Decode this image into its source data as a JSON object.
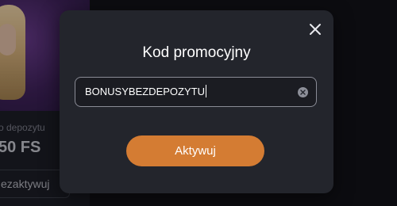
{
  "background": {
    "subtitle": "o depozytu",
    "value": "50 FS",
    "button_label": "ezaktywuj"
  },
  "modal": {
    "title": "Kod promocyjny",
    "promo_input_value": "BONUSYBEZDEPOZYTU",
    "activate_label": "Aktywuj",
    "close_icon": "close-icon",
    "clear_icon": "clear-icon"
  },
  "colors": {
    "modal_bg": "#23252c",
    "accent": "#d47c33",
    "input_border": "#8a8c96"
  }
}
